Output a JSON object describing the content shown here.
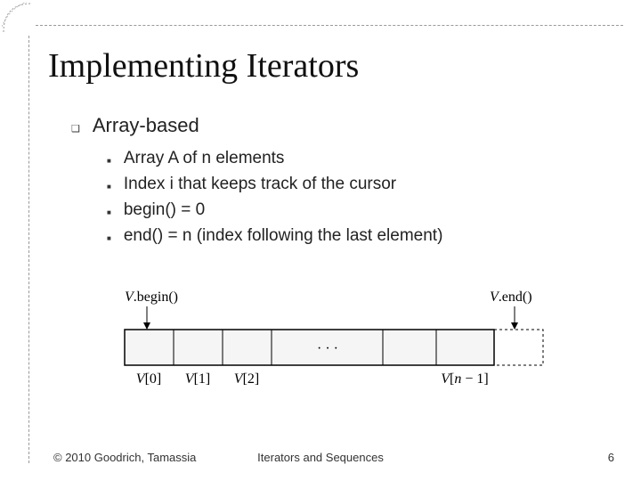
{
  "title": "Implementing Iterators",
  "bullets": {
    "l1": "Array-based",
    "l2": [
      "Array A of n elements",
      "Index i that keeps track of the cursor",
      "begin() = 0",
      "end() = n (index following the last element)"
    ]
  },
  "diagram": {
    "begin_label": "V.begin()",
    "end_label": "V.end()",
    "cells": [
      "V[0]",
      "V[1]",
      "V[2]"
    ],
    "ellipsis": "· · ·",
    "last_cell": "V[n − 1]"
  },
  "footer": {
    "left": "© 2010 Goodrich, Tamassia",
    "center": "Iterators and Sequences",
    "right": "6"
  }
}
